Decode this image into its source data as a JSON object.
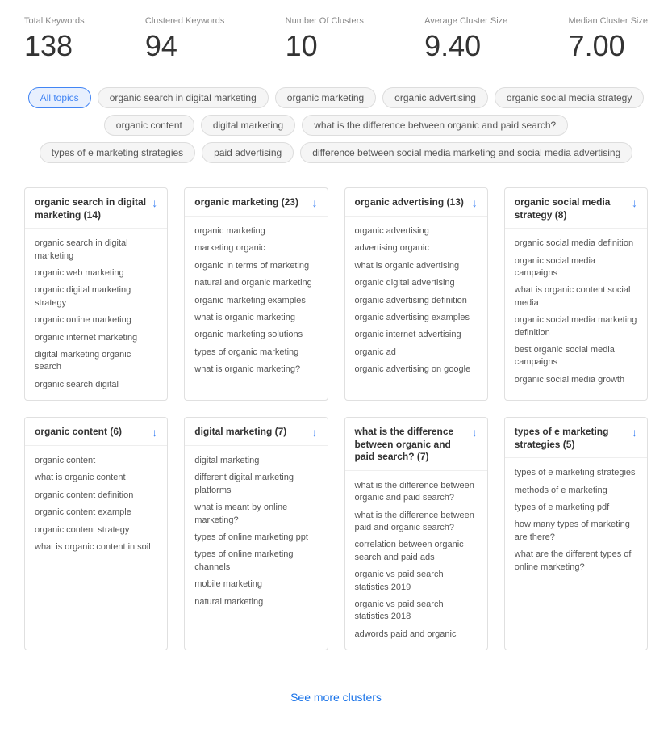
{
  "stats": [
    {
      "label": "Total Keywords",
      "value": "138"
    },
    {
      "label": "Clustered Keywords",
      "value": "94"
    },
    {
      "label": "Number Of Clusters",
      "value": "10"
    },
    {
      "label": "Average Cluster Size",
      "value": "9.40"
    },
    {
      "label": "Median Cluster Size",
      "value": "7.00"
    }
  ],
  "topics": [
    {
      "label": "All topics",
      "active": true
    },
    {
      "label": "organic search in digital marketing",
      "active": false
    },
    {
      "label": "organic marketing",
      "active": false
    },
    {
      "label": "organic advertising",
      "active": false
    },
    {
      "label": "organic social media strategy",
      "active": false
    },
    {
      "label": "organic content",
      "active": false
    },
    {
      "label": "digital marketing",
      "active": false
    },
    {
      "label": "what is the difference between organic and paid search?",
      "active": false
    },
    {
      "label": "types of e marketing strategies",
      "active": false
    },
    {
      "label": "paid advertising",
      "active": false
    },
    {
      "label": "difference between social media marketing and social media advertising",
      "active": false
    }
  ],
  "clusters": [
    {
      "title": "organic search in digital marketing (14)",
      "items": [
        "organic search in digital marketing",
        "organic web marketing",
        "organic digital marketing strategy",
        "organic online marketing",
        "organic internet marketing",
        "digital marketing organic search",
        "organic search digital"
      ]
    },
    {
      "title": "organic marketing (23)",
      "items": [
        "organic marketing",
        "marketing organic",
        "organic in terms of marketing",
        "natural and organic marketing",
        "organic marketing examples",
        "what is organic marketing",
        "organic marketing solutions",
        "types of organic marketing",
        "what is organic marketing?"
      ]
    },
    {
      "title": "organic advertising (13)",
      "items": [
        "organic advertising",
        "advertising organic",
        "what is organic advertising",
        "organic digital advertising",
        "organic advertising definition",
        "organic advertising examples",
        "organic internet advertising",
        "organic ad",
        "organic advertising on google"
      ]
    },
    {
      "title": "organic social media strategy (8)",
      "items": [
        "organic social media definition",
        "organic social media campaigns",
        "what is organic content social media",
        "organic social media marketing definition",
        "best organic social media campaigns",
        "organic social media growth"
      ]
    },
    {
      "title": "organic content (6)",
      "items": [
        "organic content",
        "what is organic content",
        "organic content definition",
        "organic content example",
        "organic content strategy",
        "what is organic content in soil"
      ]
    },
    {
      "title": "digital marketing (7)",
      "items": [
        "digital marketing",
        "different digital marketing platforms",
        "what is meant by online marketing?",
        "types of online marketing ppt",
        "types of online marketing channels",
        "mobile marketing",
        "natural marketing"
      ]
    },
    {
      "title": "what is the difference between organic and paid search? (7)",
      "items": [
        "what is the difference between organic and paid search?",
        "what is the difference between paid and organic search?",
        "correlation between organic search and paid ads",
        "organic vs paid search statistics 2019",
        "organic vs paid search statistics 2018",
        "adwords paid and organic"
      ]
    },
    {
      "title": "types of e marketing strategies (5)",
      "items": [
        "types of e marketing strategies",
        "methods of e marketing",
        "types of e marketing pdf",
        "how many types of marketing are there?",
        "what are the different types of online marketing?"
      ]
    }
  ],
  "see_more_label": "See more clusters"
}
